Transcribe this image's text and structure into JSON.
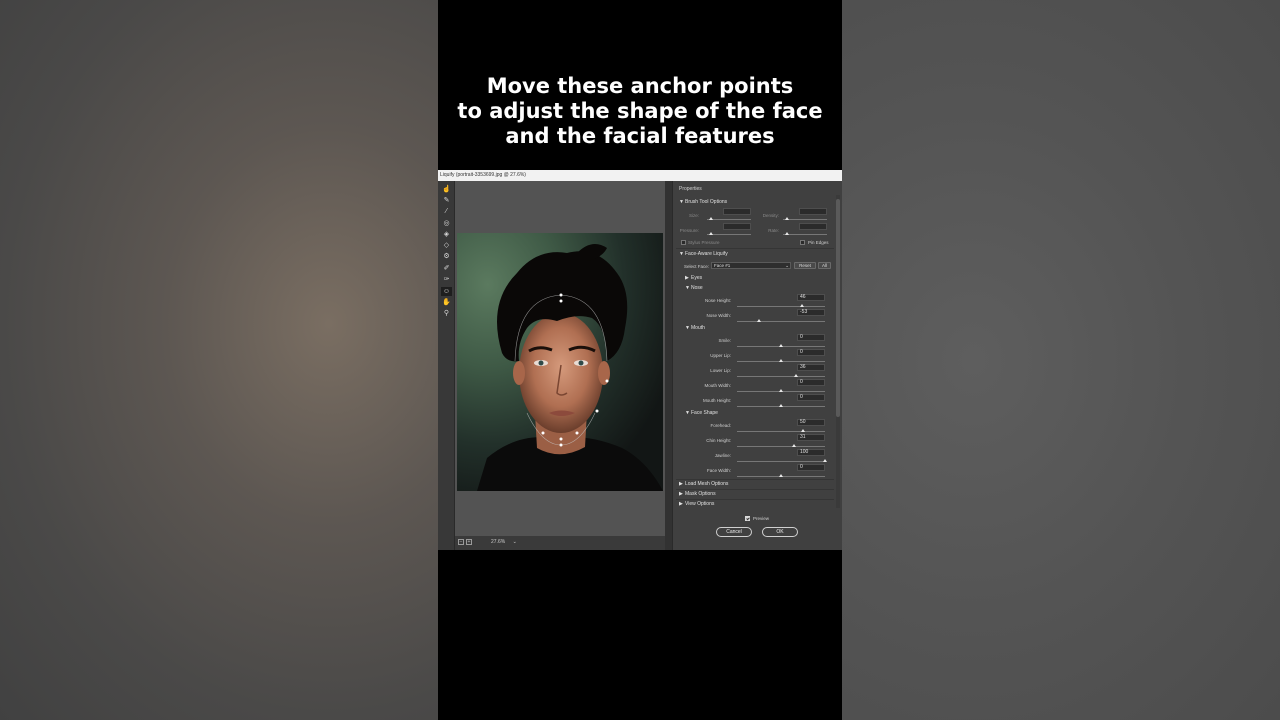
{
  "caption": {
    "line1": "Move these anchor points",
    "line2": "to adjust the shape of the face",
    "line3": "and the facial features"
  },
  "window": {
    "title": "Liquify (portrait-3353699.jpg @ 27.6%)"
  },
  "tools": [
    "forward-warp-tool",
    "reconstruct-tool",
    "smooth-tool",
    "twirl-tool",
    "pucker-tool",
    "bloat-tool",
    "push-left-tool",
    "freeze-mask-tool",
    "thaw-mask-tool",
    "face-tool",
    "hand-tool",
    "zoom-tool"
  ],
  "status": {
    "zoom_value": "27.6%"
  },
  "properties": {
    "header": "Properties",
    "brush_tool_options": {
      "title": "Brush Tool Options",
      "size_label": "Size:",
      "density_label": "Density:",
      "pressure_label": "Pressure:",
      "rate_label": "Rate:",
      "stylus_label": "Stylus Pressure",
      "pin_edges_label": "Pin Edges"
    },
    "face_aware": {
      "title": "Face-Aware Liquify",
      "select_face_label": "Select Face:",
      "select_face_value": "Face #1",
      "reset_label": "Reset",
      "all_label": "All",
      "eyes_label": "Eyes",
      "nose": {
        "title": "Nose",
        "nose_height_label": "Nose Height:",
        "nose_height_value": "46",
        "nose_width_label": "Nose Width:",
        "nose_width_value": "-53"
      },
      "mouth": {
        "title": "Mouth",
        "smile_label": "Smile:",
        "smile_value": "0",
        "upper_lip_label": "Upper Lip:",
        "upper_lip_value": "0",
        "lower_lip_label": "Lower Lip:",
        "lower_lip_value": "36",
        "mouth_width_label": "Mouth Width:",
        "mouth_width_value": "0",
        "mouth_height_label": "Mouth Height:",
        "mouth_height_value": "0"
      },
      "face_shape": {
        "title": "Face Shape",
        "forehead_label": "Forehead:",
        "forehead_value": "50",
        "chin_height_label": "Chin Height:",
        "chin_height_value": "31",
        "jawline_label": "Jawline:",
        "jawline_value": "100",
        "face_width_label": "Face Width:",
        "face_width_value": "0"
      }
    },
    "load_mesh_options": "Load Mesh Options",
    "mask_options": "Mask Options",
    "view_options": "View Options",
    "preview_label": "Preview",
    "cancel_label": "Cancel",
    "ok_label": "OK"
  }
}
